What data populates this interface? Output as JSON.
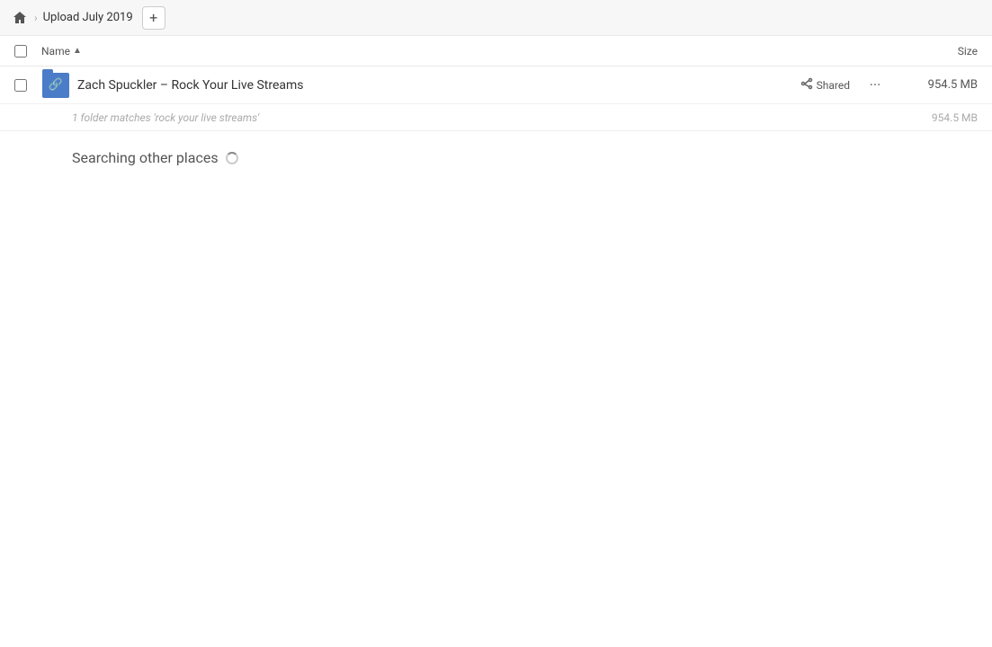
{
  "breadcrumb": {
    "home_icon": "🏠",
    "separator": "›",
    "title": "Upload July 2019",
    "add_icon": "+"
  },
  "columns": {
    "name_label": "Name",
    "sort_arrow": "▲",
    "size_label": "Size"
  },
  "file_row": {
    "name": "Zach Spuckler – Rock Your Live Streams",
    "shared_label": "Shared",
    "size": "954.5 MB"
  },
  "search_info": {
    "text": "1 folder matches 'rock your live streams'",
    "size": "954.5 MB"
  },
  "searching": {
    "label": "Searching other places"
  }
}
